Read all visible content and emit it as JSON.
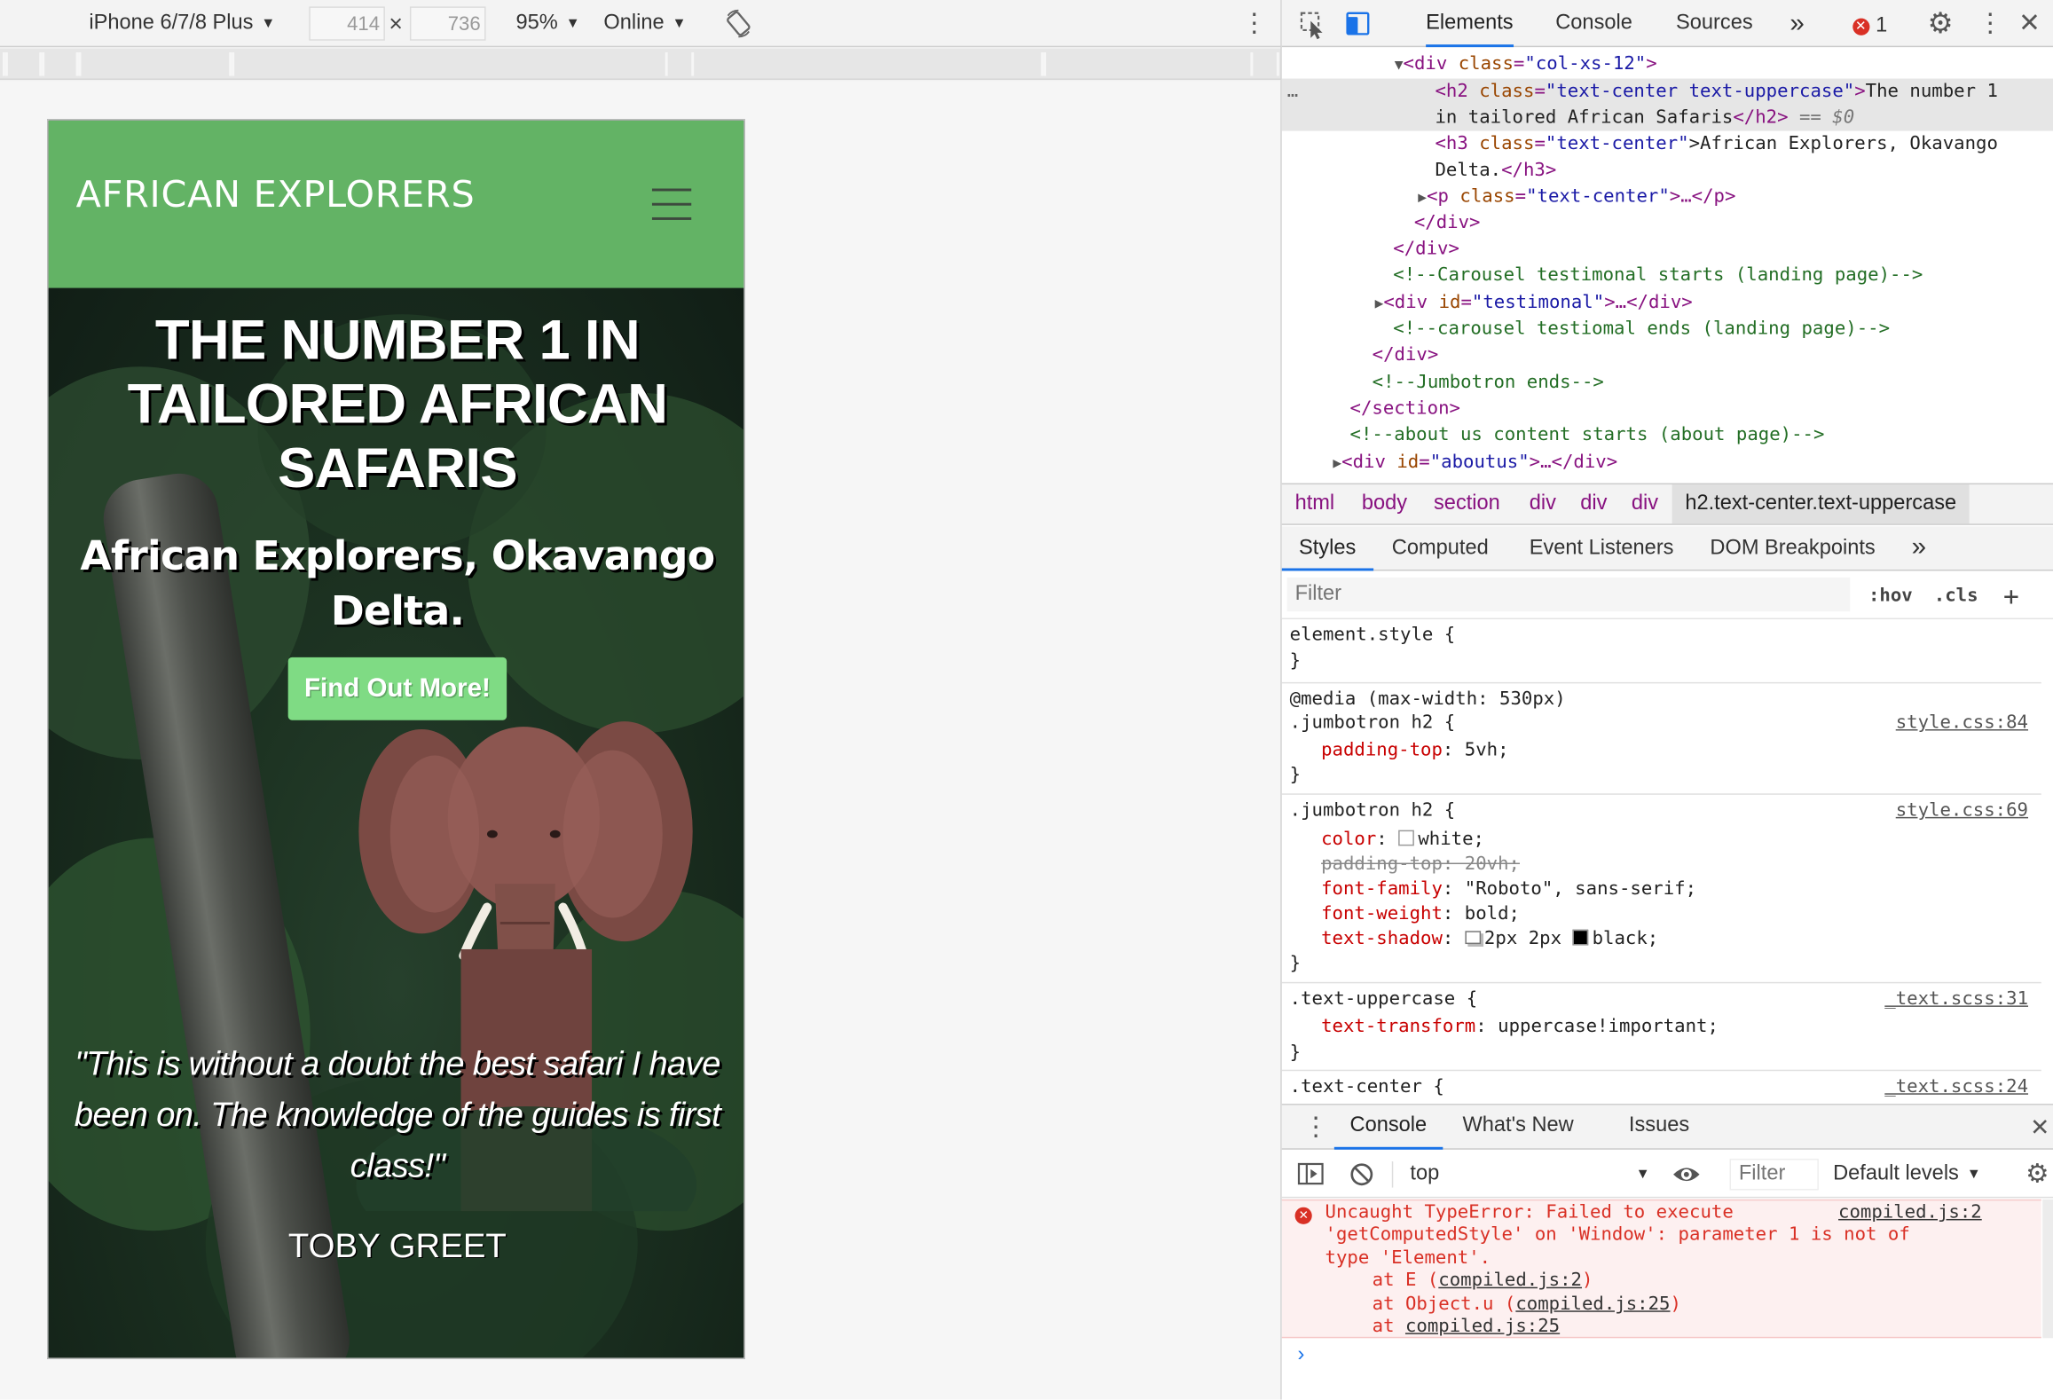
{
  "device_toolbar": {
    "device": "iPhone 6/7/8 Plus",
    "width": "414",
    "height": "736",
    "times": "×",
    "zoom": "95%",
    "network": "Online"
  },
  "site": {
    "brand": "AFRICAN EXPLORERS",
    "headline": "The number 1 in tailored African Safaris",
    "subhead": "African Explorers, Okavango Delta.",
    "cta": "Find Out More!",
    "quote": "\"This is without a doubt the best safari I have been on. The knowledge of the guides is first class!\"",
    "author": "TOBY GREET"
  },
  "devtools": {
    "tabs": [
      "Elements",
      "Console",
      "Sources"
    ],
    "more": "»",
    "error_count": "1",
    "dom": {
      "l1_tag_open": "<div ",
      "l1_attr": "class",
      "l1_val": "\"col-xs-12\"",
      "l1_close": ">",
      "l2_tag": "<h2 ",
      "l2_attr": "class",
      "l2_val": "\"text-center text-uppercase\"",
      "l2_text_a": "The number 1",
      "l2_text_b": "in tailored African Safaris",
      "l2_end": "</h2>",
      "l2_marker": " == $0",
      "l3_tag": "<h3 ",
      "l3_attr": "class",
      "l3_val": "\"text-center\"",
      "l3_text_a": ">African Explorers, Okavango",
      "l3_text_b": "Delta.",
      "l3_end": "</h3>",
      "l4_tag": "<p ",
      "l4_attr": "class",
      "l4_val": "\"text-center\"",
      "l4_rest": ">…</p>",
      "l5": "</div>",
      "l6": "</div>",
      "l7": "<!--Carousel testimonal starts (landing page)-->",
      "l8_tag": "<div ",
      "l8_attr": "id",
      "l8_val": "\"testimonal\"",
      "l8_rest": ">…</div>",
      "l9": "<!--carousel testiomal ends (landing page)-->",
      "l10": "</div>",
      "l11": "<!--Jumbotron ends-->",
      "l12": "</section>",
      "l13": "<!--about us content starts (about page)-->",
      "l14_tag": "<div ",
      "l14_attr": "id",
      "l14_val": "\"aboutus\"",
      "l14_rest": ">…</div>",
      "ellipsis": "…"
    },
    "breadcrumbs": [
      "html",
      "body",
      "section",
      "div",
      "div",
      "div",
      "h2.text-center.text-uppercase"
    ],
    "style_tabs": [
      "Styles",
      "Computed",
      "Event Listeners",
      "DOM Breakpoints"
    ],
    "filter_placeholder": "Filter",
    "hov": ":hov",
    "cls": ".cls",
    "rules": {
      "r1_sel": "element.style {",
      "r1_end": "}",
      "r2_media": "@media (max-width: 530px)",
      "r2_sel": ".jumbotron h2 {",
      "r2_src": "style.css:84",
      "r2_p1_name": "padding-top",
      "r2_p1_val": ": 5vh;",
      "r2_end": "}",
      "r3_sel": ".jumbotron h2 {",
      "r3_src": "style.css:69",
      "r3_p1_name": "color",
      "r3_p1_val": "white;",
      "r3_p2": "padding-top: 20vh;",
      "r3_p3_name": "font-family",
      "r3_p3_val": ": \"Roboto\", sans-serif;",
      "r3_p4_name": "font-weight",
      "r3_p4_val": ": bold;",
      "r3_p5_name": "text-shadow",
      "r3_p5_val_a": "2px 2px ",
      "r3_p5_val_b": "black;",
      "r3_end": "}",
      "r4_sel": ".text-uppercase {",
      "r4_src": "_text.scss:31",
      "r4_p1_name": "text-transform",
      "r4_p1_val": ": uppercase!important;",
      "r4_end": "}",
      "r5_sel": ".text-center {",
      "r5_src": "_text.scss:24"
    },
    "drawer_tabs": [
      "Console",
      "What's New",
      "Issues"
    ],
    "console_context": "top",
    "console_filter_placeholder": "Filter",
    "log_levels": "Default levels",
    "error": {
      "line1": "Uncaught TypeError: Failed to execute",
      "src": "compiled.js:2",
      "line2": "'getComputedStyle' on 'Window': parameter 1 is not of",
      "line3": "type 'Element'.",
      "at1_pre": "at E (",
      "at1_link": "compiled.js:2",
      "at1_post": ")",
      "at2_pre": "at Object.u (",
      "at2_link": "compiled.js:25",
      "at2_post": ")",
      "at3_pre": "at ",
      "at3_link": "compiled.js:25"
    },
    "prompt": "›"
  },
  "colors": {
    "nav_green": "#63b365",
    "cta_green": "#7fdb84",
    "devtools_accent": "#1a73e8",
    "error_red": "#d93025"
  }
}
